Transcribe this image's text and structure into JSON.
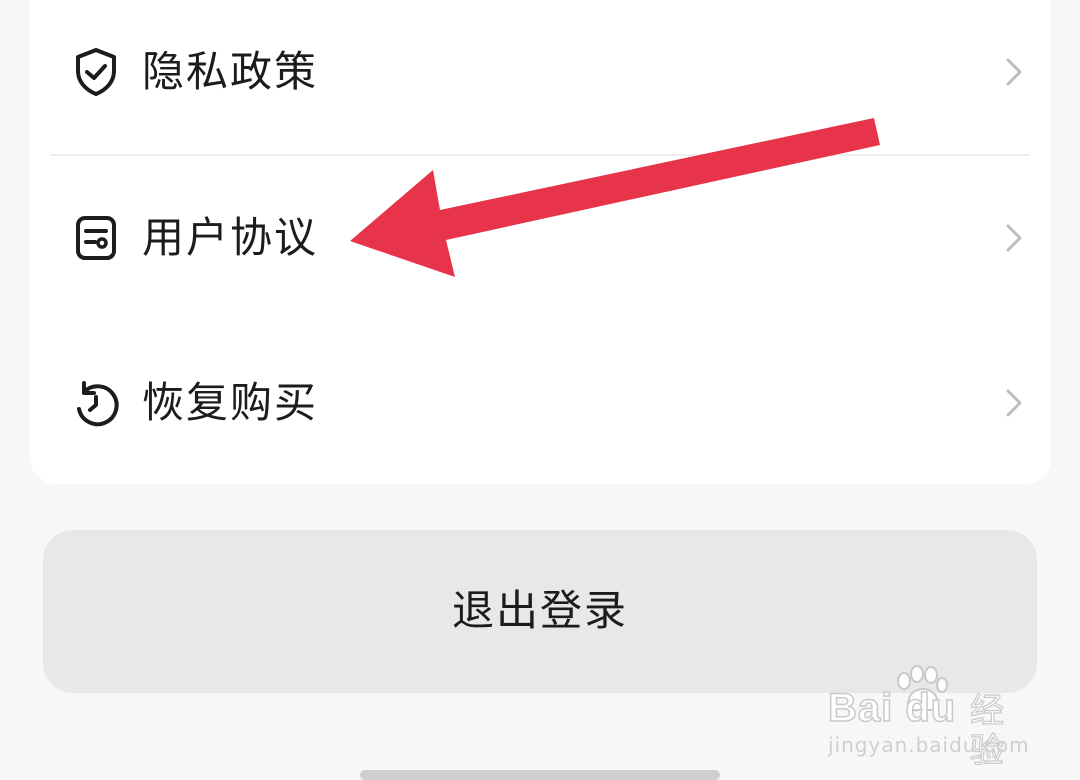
{
  "menu": {
    "items": [
      {
        "label": "隐私政策",
        "icon": "shield-check-icon"
      },
      {
        "label": "用户协议",
        "icon": "document-icon"
      },
      {
        "label": "恢复购买",
        "icon": "restore-icon"
      }
    ]
  },
  "logout": {
    "label": "退出登录"
  },
  "annotation": {
    "arrow_color": "#e8344a",
    "points_to": "用户协议"
  },
  "watermark": {
    "brand": "Bai du",
    "product": "经验",
    "url": "jingyan.baidu.com"
  }
}
